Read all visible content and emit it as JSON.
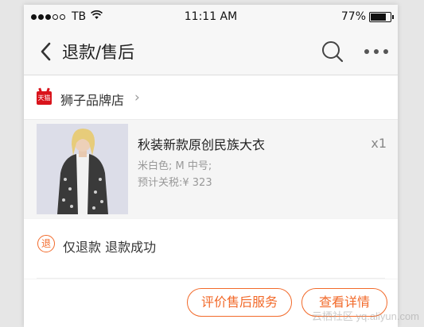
{
  "status_bar": {
    "carrier": "TB",
    "time": "11:11 AM",
    "battery": "77%",
    "battery_level": 0.77
  },
  "nav": {
    "title": "退款/售后",
    "icons": [
      "back-chevron-icon",
      "search-icon",
      "more-icon"
    ]
  },
  "store": {
    "badge_text": "天猫",
    "name": "狮子品牌店",
    "chevron": "›"
  },
  "product": {
    "name": "秋装新款原创民族大衣",
    "quantity": "x1",
    "spec": "米白色; M 中号;",
    "tax": "预计关税:¥ 323"
  },
  "refund": {
    "badge": "退",
    "status": "仅退款 退款成功"
  },
  "actions": {
    "review_label": "评价售后服务",
    "detail_label": "查看详情"
  },
  "watermark": "云栖社区 yq.aliyun.com",
  "colors": {
    "accent": "#f26a2a",
    "tmall_red": "#d9141c"
  }
}
